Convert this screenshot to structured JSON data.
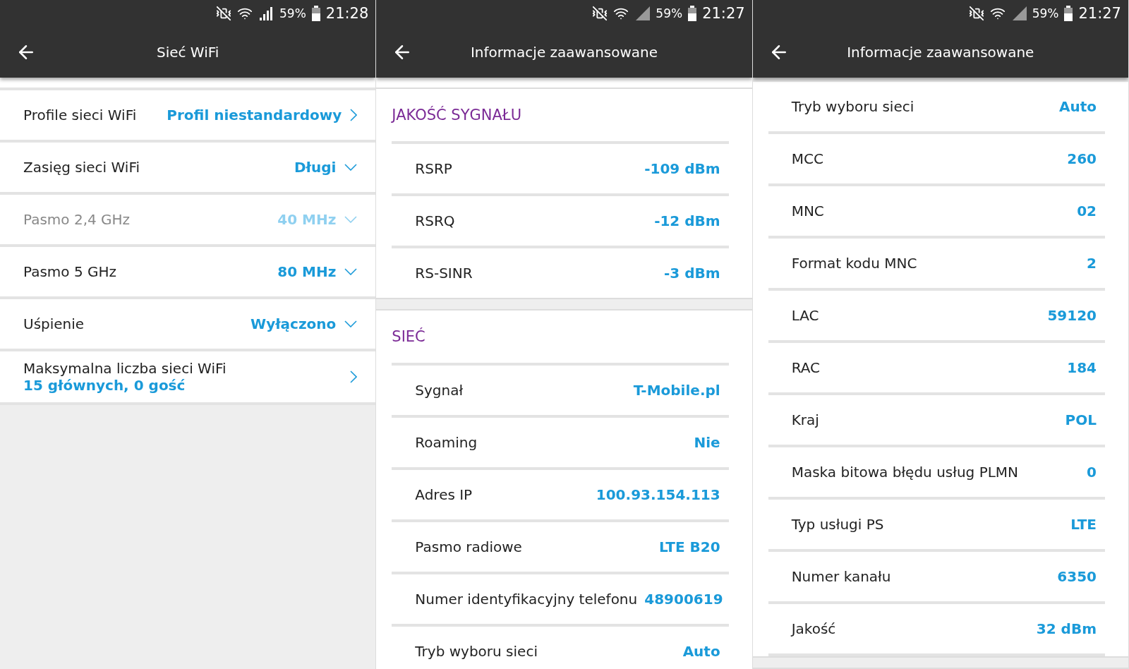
{
  "screens": [
    {
      "kind": "settings",
      "status": {
        "battery": "59%",
        "time": "21:28"
      },
      "title": "Sieć WiFi",
      "rows": [
        {
          "kind": "link",
          "label": "Profile sieci WiFi",
          "value": "Profil niestandardowy",
          "disabled": false
        },
        {
          "kind": "dropdown",
          "label": "Zasięg sieci WiFi",
          "value": "Długi",
          "disabled": false
        },
        {
          "kind": "dropdown",
          "label": "Pasmo 2,4 GHz",
          "value": "40 MHz",
          "disabled": true
        },
        {
          "kind": "dropdown",
          "label": "Pasmo 5 GHz",
          "value": "80 MHz",
          "disabled": false
        },
        {
          "kind": "dropdown",
          "label": "Uśpienie",
          "value": "Wyłączono",
          "disabled": false
        },
        {
          "kind": "stacked",
          "label": "Maksymalna liczba sieci WiFi",
          "value": "15 głównych, 0 gość",
          "disabled": false
        }
      ]
    },
    {
      "kind": "info",
      "status": {
        "battery": "59%",
        "time": "21:27"
      },
      "title": "Informacje zaawansowane",
      "sections": [
        {
          "heading": "JAKOŚĆ SYGNAŁU",
          "rows": [
            {
              "label": "RSRP",
              "value": "-109 dBm"
            },
            {
              "label": "RSRQ",
              "value": "-12 dBm"
            },
            {
              "label": "RS-SINR",
              "value": "-3 dBm"
            }
          ]
        },
        {
          "heading": "SIEĆ",
          "rows": [
            {
              "label": "Sygnał",
              "value": "T-Mobile.pl"
            },
            {
              "label": "Roaming",
              "value": "Nie"
            },
            {
              "label": "Adres IP",
              "value": "100.93.154.113"
            },
            {
              "label": "Pasmo radiowe",
              "value": "LTE B20"
            },
            {
              "label": "Numer identyfikacyjny telefonu",
              "value": "48900619"
            },
            {
              "label": "Tryb wyboru sieci",
              "value": "Auto"
            }
          ]
        }
      ]
    },
    {
      "kind": "info",
      "status": {
        "battery": "59%",
        "time": "21:27"
      },
      "title": "Informacje zaawansowane",
      "sections": [
        {
          "rows": [
            {
              "label": "Tryb wyboru sieci",
              "value": "Auto"
            },
            {
              "label": "MCC",
              "value": "260"
            },
            {
              "label": "MNC",
              "value": "02"
            },
            {
              "label": "Format kodu MNC",
              "value": "2"
            },
            {
              "label": "LAC",
              "value": "59120"
            },
            {
              "label": "RAC",
              "value": "184"
            },
            {
              "label": "Kraj",
              "value": "POL"
            },
            {
              "label": "Maska bitowa błędu usług PLMN",
              "value": "0"
            },
            {
              "label": "Typ usługi PS",
              "value": "LTE"
            },
            {
              "label": "Numer kanału",
              "value": "6350"
            },
            {
              "label": "Jakość",
              "value": "32 dBm"
            }
          ]
        }
      ]
    }
  ]
}
